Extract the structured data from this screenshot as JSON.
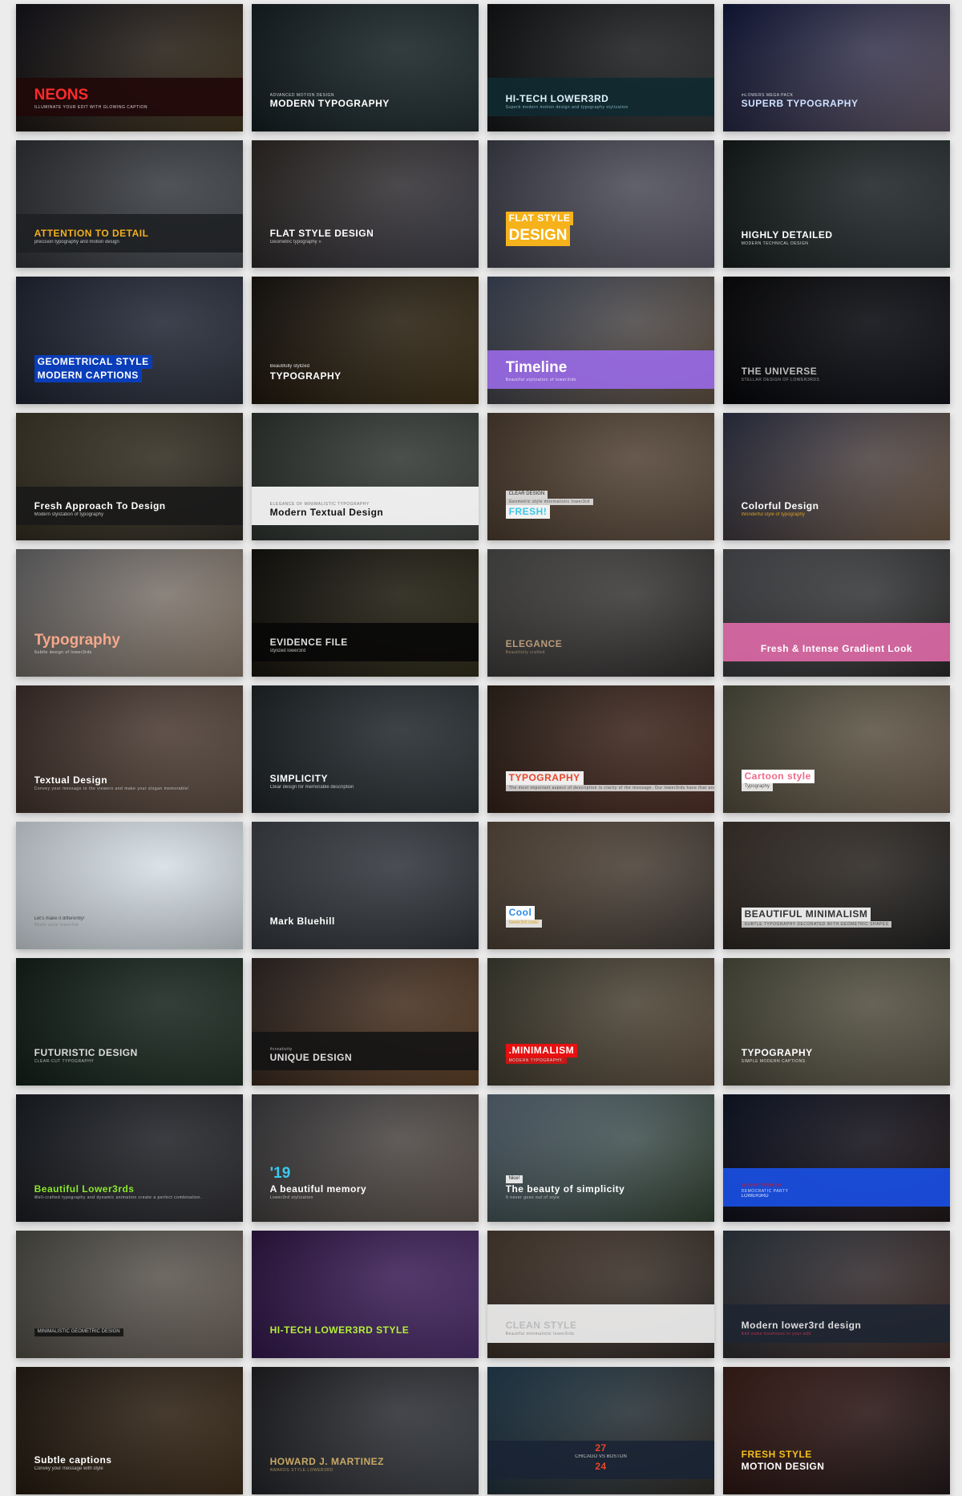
{
  "tiles": [
    {
      "bg": [
        "#0d0c14",
        "#3b2e18"
      ],
      "band": "#200808",
      "lines": [
        {
          "text": "NEONS",
          "role": "big",
          "color": "#ff2a2a"
        },
        {
          "text": "ILLUMINATE YOUR EDIT WITH GLOWING CAPTION",
          "role": "tiny",
          "color": "#ffffff"
        }
      ]
    },
    {
      "bg": [
        "#101a1e",
        "#1c2a2c"
      ],
      "lines": [
        {
          "text": "ADVANCED MOTION DESIGN",
          "role": "tiny",
          "color": "#ffffff"
        },
        {
          "text": "MODERN TYPOGRAPHY",
          "role": "title",
          "color": "#ffffff"
        }
      ]
    },
    {
      "bg": [
        "#0a0c0e",
        "#2a2c2e"
      ],
      "band": "#0f2a30",
      "lines": [
        {
          "text": "HI-TECH LOWER3RD",
          "role": "title",
          "color": "#e0f4ff"
        },
        {
          "text": "Superb modern motion design and typography stylization",
          "role": "tiny",
          "color": "#9fd4e8"
        }
      ]
    },
    {
      "bg": [
        "#0b1238",
        "#5a5060"
      ],
      "lines": [
        {
          "text": "mLOWERS MEGA PACK",
          "role": "tiny",
          "color": "#ffffff"
        },
        {
          "text": "SUPERB TYPOGRAPHY",
          "role": "title",
          "color": "#cfe0ff"
        }
      ]
    },
    {
      "bg": [
        "#2a2c30",
        "#44484e"
      ],
      "band": "#1e2024",
      "lines": [
        {
          "text": "ATTENTION TO DETAIL",
          "role": "title",
          "color": "#f2b01e"
        },
        {
          "text": "precision typography and motion design",
          "role": "sub",
          "color": "#dddddd"
        }
      ]
    },
    {
      "bg": [
        "#2a2420",
        "#3a3a44"
      ],
      "lines": [
        {
          "text": "FLAT STYLE DESIGN",
          "role": "title",
          "color": "#ffffff"
        },
        {
          "text": "Geometric typography »",
          "role": "sub",
          "color": "#dddddd"
        }
      ]
    },
    {
      "bg": [
        "#3a3c48",
        "#5a5866"
      ],
      "lines": [
        {
          "text": "FLAT STYLE",
          "role": "title",
          "color": "#ffffff",
          "bgc": "#f5b21a"
        },
        {
          "text": "DESIGN",
          "role": "big",
          "color": "#ffffff",
          "bgc": "#f5b21a"
        }
      ]
    },
    {
      "bg": [
        "#0e1414",
        "#2a3234"
      ],
      "lines": [
        {
          "text": "HIGHLY DETAILED",
          "role": "title",
          "color": "#ffffff"
        },
        {
          "text": "MODERN TECHNICAL DESIGN",
          "role": "tiny",
          "color": "#ffffff"
        }
      ]
    },
    {
      "bg": [
        "#1a2030",
        "#2a2e3a"
      ],
      "lines": [
        {
          "text": "GEOMETRICAL STYLE",
          "role": "title",
          "color": "#ffffff",
          "bgc": "#0a3db8"
        },
        {
          "text": "MODERN CAPTIONS",
          "role": "title",
          "color": "#ffffff",
          "bgc": "#0a3db8"
        }
      ]
    },
    {
      "bg": [
        "#120e0a",
        "#3a2c14"
      ],
      "lines": [
        {
          "text": "Beautifully stylized",
          "role": "sub",
          "color": "#ffffff"
        },
        {
          "text": "TYPOGRAPHY",
          "role": "title",
          "color": "#ffffff"
        }
      ]
    },
    {
      "bg": [
        "#3a4458",
        "#5a4a3a"
      ],
      "band": "#9a6ae8",
      "lines": [
        {
          "text": "Timeline",
          "role": "big",
          "color": "#ffffff"
        },
        {
          "text": "Beautiful stylization of lower3rds",
          "role": "tiny",
          "color": "#ffffff"
        }
      ]
    },
    {
      "bg": [
        "#020204",
        "#0a0c14"
      ],
      "lines": [
        {
          "text": "THE UNIVERSE",
          "role": "title",
          "color": "#bbbbbb"
        },
        {
          "text": "STELLAR DESIGN OF LOWER3RDS",
          "role": "tiny",
          "color": "#bbbbbb"
        }
      ]
    },
    {
      "bg": [
        "#3a3424",
        "#2a261e"
      ],
      "band": "#1a1a1a",
      "lines": [
        {
          "text": "Fresh Approach To Design",
          "role": "title",
          "color": "#ffffff"
        },
        {
          "text": "Modern stylization of typography",
          "role": "sub",
          "color": "#dddddd"
        }
      ]
    },
    {
      "bg": [
        "#2a302c",
        "#3a3e3a"
      ],
      "band": "#ffffff",
      "lines": [
        {
          "text": "ELEGANCE OF MINIMALISTIC TYPOGRAPHY",
          "role": "tiny",
          "color": "#555555"
        },
        {
          "text": "Modern Textual Design",
          "role": "title",
          "color": "#111111"
        }
      ]
    },
    {
      "bg": [
        "#4a3a2c",
        "#5a4a3c"
      ],
      "lines": [
        {
          "text": "CLEAR DESIGN",
          "role": "sub",
          "color": "#222222",
          "bgc": "#f2f2f2"
        },
        {
          "text": "Geometric style minimalistic lower3rd",
          "role": "tiny",
          "color": "#555555",
          "bgc": "#f2f2f2"
        },
        {
          "text": "FRESH!",
          "role": "title",
          "color": "#3cc8e8",
          "bgc": "#f2f2f2"
        }
      ]
    },
    {
      "bg": [
        "#2a2e44",
        "#6a5440"
      ],
      "lines": [
        {
          "text": "Colorful Design",
          "role": "title",
          "color": "#ffffff"
        },
        {
          "text": "Wonderful style of typography",
          "role": "sub",
          "color": "#f2b01e"
        }
      ]
    },
    {
      "bg": [
        "#6a6a6c",
        "#8a7a6a"
      ],
      "lines": [
        {
          "text": "Typography",
          "role": "big",
          "color": "#f5a88a"
        },
        {
          "text": "Subtle design of lower3rds",
          "role": "tiny",
          "color": "#eeeeee"
        }
      ]
    },
    {
      "bg": [
        "#0e0c08",
        "#2a2614"
      ],
      "band": "#080808",
      "lines": [
        {
          "text": "EVIDENCE FILE",
          "role": "title",
          "color": "#dddddd"
        },
        {
          "text": "stylized lower3rd",
          "role": "sub",
          "color": "#dddddd"
        }
      ]
    },
    {
      "bg": [
        "#4a4a48",
        "#2a2626"
      ],
      "lines": [
        {
          "text": "ELEGANCE",
          "role": "title",
          "color": "#b89a7a"
        },
        {
          "text": "Beautifully crafted",
          "role": "tiny",
          "color": "#b89a7a"
        }
      ]
    },
    {
      "bg": [
        "#4a4c50",
        "#222222"
      ],
      "band": "#e06aa8",
      "align": "center",
      "lines": [
        {
          "text": "Fresh & Intense Gradient Look",
          "role": "title",
          "color": "#ffffff"
        }
      ]
    },
    {
      "bg": [
        "#3a2a26",
        "#5a4a3e"
      ],
      "lines": [
        {
          "text": "Textual Design",
          "role": "title",
          "color": "#ffffff"
        },
        {
          "text": "Convey your message to the viewers and make your slogan memorable!",
          "role": "tiny",
          "color": "#dddddd"
        }
      ]
    },
    {
      "bg": [
        "#1a2024",
        "#2a3034"
      ],
      "lines": [
        {
          "text": "SIMPLICITY",
          "role": "title",
          "color": "#ffffff"
        },
        {
          "text": "Clear design for memorable description",
          "role": "sub",
          "color": "#dddddd"
        }
      ]
    },
    {
      "bg": [
        "#2a1e16",
        "#4a2a20"
      ],
      "lines": [
        {
          "text": "TYPOGRAPHY",
          "role": "title",
          "color": "#e8452a",
          "bgc": "#eeeeee"
        },
        {
          "text": "The most important aspect of description is clarity of the message. Our lower3rds have that and a stunning motion design to complete the whole.",
          "role": "tiny",
          "color": "#555555",
          "bgc": "#eeeeee"
        }
      ]
    },
    {
      "bg": [
        "#4a4a3a",
        "#6a5a4a"
      ],
      "lines": [
        {
          "text": "Cartoon style",
          "role": "title",
          "color": "#f06a8a",
          "bgc": "#ffffff"
        },
        {
          "text": "Typography",
          "role": "sub",
          "color": "#555555",
          "bgc": "#ffffff"
        }
      ]
    },
    {
      "bg": [
        "#dfe8ee",
        "#cfd8de"
      ],
      "lines": [
        {
          "text": "Let's make it differently!",
          "role": "sub",
          "color": "#333333"
        },
        {
          "text": "Photo style lower3rd",
          "role": "tiny",
          "color": "#777777"
        }
      ]
    },
    {
      "bg": [
        "#3a3e44",
        "#2a2e34"
      ],
      "lines": [
        {
          "text": "Mark Bluehill",
          "role": "title",
          "color": "#ffffff"
        }
      ]
    },
    {
      "bg": [
        "#5a4a3a",
        "#3a3430"
      ],
      "lines": [
        {
          "text": "Cool",
          "role": "title",
          "color": "#2a8ae8",
          "bgc": "#ffffff"
        },
        {
          "text": "lower3rd look!",
          "role": "sub",
          "color": "#f2b01e",
          "bgc": "#ffffff"
        }
      ]
    },
    {
      "bg": [
        "#3a3028",
        "#1a1a1a"
      ],
      "lines": [
        {
          "text": "BEAUTIFUL MINIMALISM",
          "role": "title",
          "color": "#333333",
          "bgc": "#e6e6e6"
        },
        {
          "text": "SUBTLE TYPOGRAPHY DECORATED WITH GEOMETRIC SHAPES",
          "role": "tiny",
          "color": "#555555",
          "bgc": "#e6e6e6"
        }
      ]
    },
    {
      "bg": [
        "#0e1a14",
        "#1e2e24"
      ],
      "lines": [
        {
          "text": "FUTURISTIC DESIGN",
          "role": "title",
          "color": "#dddddd"
        },
        {
          "text": "CLEAR-CUT TYPOGRAPHY",
          "role": "tiny",
          "color": "#dddddd"
        }
      ]
    },
    {
      "bg": [
        "#2a2220",
        "#5a3a20"
      ],
      "band": "#141414",
      "lines": [
        {
          "text": "#creativity",
          "role": "tiny",
          "color": "#dddddd"
        },
        {
          "text": "UNIQUE DESIGN",
          "role": "title",
          "color": "#dddddd"
        }
      ]
    },
    {
      "bg": [
        "#3a3a2e",
        "#5a4a3a"
      ],
      "lines": [
        {
          "text": ".MINIMALISM",
          "role": "title",
          "color": "#ffffff",
          "bgc": "#e81010"
        },
        {
          "text": "MODERN TYPOGRAPHY.",
          "role": "tiny",
          "color": "#ffffff",
          "bgc": "#e81010"
        }
      ]
    },
    {
      "bg": [
        "#4a4a3a",
        "#5a5446"
      ],
      "lines": [
        {
          "text": "TYPOGRAPHY",
          "role": "title",
          "color": "#ffffff"
        },
        {
          "text": "SIMPLE MODERN CAPTIONS",
          "role": "tiny",
          "color": "#ffffff"
        }
      ]
    },
    {
      "bg": [
        "#14181e",
        "#2a2a2e"
      ],
      "lines": [
        {
          "text": "Beautiful Lower3rds",
          "role": "title",
          "color": "#8ae82a"
        },
        {
          "text": "Well-crafted typography and dynamic animation create a perfect combination.",
          "role": "tiny",
          "color": "#dddddd"
        }
      ]
    },
    {
      "bg": [
        "#3a3a3e",
        "#5a5048"
      ],
      "lines": [
        {
          "text": "'19",
          "role": "big",
          "color": "#3cc8f0"
        },
        {
          "text": "A beautiful memory",
          "role": "title",
          "color": "#ffffff"
        },
        {
          "text": "Lower3rd stylization",
          "role": "tiny",
          "color": "#dddddd"
        }
      ]
    },
    {
      "bg": [
        "#5a6a7a",
        "#2a3a2a"
      ],
      "lines": [
        {
          "text": "Nice!",
          "role": "sub",
          "color": "#111111",
          "bgc": "#ffffff"
        },
        {
          "text": "The beauty of simplicity",
          "role": "title",
          "color": "#ffffff"
        },
        {
          "text": "It never goes out of style",
          "role": "tiny",
          "color": "#dddddd"
        }
      ]
    },
    {
      "bg": [
        "#0a1024",
        "#1a1010"
      ],
      "band": "#1a50e8",
      "lines": [
        {
          "text": "JEREMY PARKER",
          "role": "sub",
          "color": "#e81010"
        },
        {
          "text": "DEMOCRATIC PARTY",
          "role": "tiny",
          "color": "#ffffff"
        },
        {
          "text": "LOWER3RD",
          "role": "sub",
          "color": "#ffffff"
        }
      ]
    },
    {
      "bg": [
        "#4a4a44",
        "#6a6058"
      ],
      "lines": [
        {
          "text": "MINIMALISTIC GEOMETRIC DESIGN",
          "role": "sub",
          "color": "#dddddd",
          "bgc": "#111111"
        }
      ]
    },
    {
      "bg": [
        "#2a1040",
        "#4a2a6a"
      ],
      "lines": [
        {
          "text": "HI-TECH LOWER3RD STYLE",
          "role": "title",
          "color": "#b4f03a"
        }
      ]
    },
    {
      "bg": [
        "#4a3a2e",
        "#2a2420"
      ],
      "band": "#f4f4f4",
      "lines": [
        {
          "text": "CLEAN STYLE",
          "role": "title",
          "color": "#bbbbbb"
        },
        {
          "text": "Beautiful minimalistic lower3rds",
          "role": "tiny",
          "color": "#777777"
        }
      ]
    },
    {
      "bg": [
        "#2a343e",
        "#3a2420"
      ],
      "band": "#1e2632",
      "lines": [
        {
          "text": "Modern lower3rd design",
          "role": "title",
          "color": "#dddddd"
        },
        {
          "text": "Add some freshness to your edit",
          "role": "tiny",
          "color": "#e8355a"
        }
      ]
    },
    {
      "bg": [
        "#1e160e",
        "#3a2816"
      ],
      "lines": [
        {
          "text": "Subtle captions",
          "role": "title",
          "color": "#ffffff"
        },
        {
          "text": "Convey your message with style",
          "role": "sub",
          "color": "#dddddd"
        }
      ]
    },
    {
      "bg": [
        "#1a1a1e",
        "#3a3e44"
      ],
      "lines": [
        {
          "text": "HOWARD J. MARTINEZ",
          "role": "title",
          "color": "#c9a866"
        },
        {
          "text": "AWARDS STYLE LOWER3RD",
          "role": "tiny",
          "color": "#c9a866"
        }
      ]
    },
    {
      "bg": [
        "#1e3a4e",
        "#2a2620"
      ],
      "band": "#1a2434",
      "align": "center",
      "lines": [
        {
          "text": "27",
          "role": "title",
          "color": "#e8452a"
        },
        {
          "text": "CHICAGO VS BOSTON",
          "role": "sub",
          "color": "#dddddd"
        },
        {
          "text": "24",
          "role": "title",
          "color": "#e8452a"
        }
      ]
    },
    {
      "bg": [
        "#3a1a14",
        "#1a1012"
      ],
      "lines": [
        {
          "text": "FRESH STYLE",
          "role": "title",
          "color": "#f2c01e"
        },
        {
          "text": "MOTION DESIGN",
          "role": "title",
          "color": "#ffffff"
        }
      ]
    }
  ]
}
